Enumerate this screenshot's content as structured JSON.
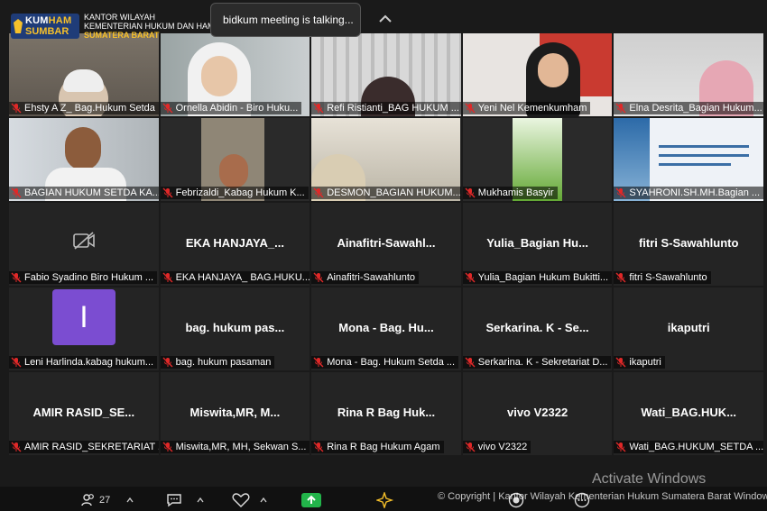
{
  "app": {
    "logo": {
      "badge_line1_a": "KUM",
      "badge_line1_b": "HAM",
      "badge_line2": "SUMBAR",
      "line1": "KANTOR WILAYAH",
      "line2": "KEMENTERIAN HUKUM DAN HAM",
      "line3": "SUMATERA BARAT"
    },
    "talking_indicator": "bidkum meeting is talking...",
    "watermark": "Activate Windows",
    "copyright": "© Copyright | Kantor Wilayah Kementerian Hukum Sumatera Barat Window"
  },
  "participants": [
    {
      "label": "Ehsty A Z_ Bag.Hukum Setda ...",
      "type": "video",
      "scene": "room-grey"
    },
    {
      "label": "Ornella Abidin - Biro Huku...",
      "type": "video",
      "scene": "hijab-white"
    },
    {
      "label": "Refi Ristianti_BAG HUKUM ...",
      "type": "video",
      "scene": "blinds"
    },
    {
      "label": "Yeni Nel Kemenkumham",
      "type": "video",
      "scene": "red-banner"
    },
    {
      "label": "Elna Desrita_Bagian Hukum...",
      "type": "video",
      "scene": "pink-hijab"
    },
    {
      "label": "BAGIAN HUKUM SETDA KA...",
      "type": "video",
      "scene": "man-office"
    },
    {
      "label": "Febrizaldi_Kabag Hukum K...",
      "type": "video",
      "scene": "man-dark"
    },
    {
      "label": "DESMON_BAGIAN HUKUM...",
      "type": "video",
      "scene": "ceiling"
    },
    {
      "label": "Mukhamis Basyir",
      "type": "video",
      "scene": "grass"
    },
    {
      "label": "SYAHRONI.SH.MH.Bagian ...",
      "type": "video",
      "scene": "slide"
    },
    {
      "label": "Fabio Syadino Biro Hukum ...",
      "type": "camoff",
      "big": ""
    },
    {
      "label": "EKA HANJAYA_ BAG.HUKU...",
      "type": "name",
      "big": "EKA HANJAYA_..."
    },
    {
      "label": "Ainafitri-Sawahlunto",
      "type": "name",
      "big": "Ainafitri-Sawahl..."
    },
    {
      "label": "Yulia_Bagian Hukum Bukitti...",
      "type": "name",
      "big": "Yulia_Bagian Hu..."
    },
    {
      "label": "fitri S-Sawahlunto",
      "type": "name",
      "big": "fitri S-Sawahlunto"
    },
    {
      "label": "Leni Harlinda.kabag hukum...",
      "type": "avatar",
      "big": "I"
    },
    {
      "label": "bag. hukum pasaman",
      "type": "name",
      "big": "bag. hukum pas..."
    },
    {
      "label": "Mona - Bag. Hukum Setda ...",
      "type": "name",
      "big": "Mona - Bag. Hu..."
    },
    {
      "label": "Serkarina. K - Sekretariat D...",
      "type": "name",
      "big": "Serkarina. K - Se..."
    },
    {
      "label": "ikaputri",
      "type": "name",
      "big": "ikaputri"
    },
    {
      "label": "AMIR RASID_SEKRETARIAT ...",
      "type": "name",
      "big": "AMIR RASID_SE..."
    },
    {
      "label": "Miswita,MR, MH, Sekwan S...",
      "type": "name",
      "big": "Miswita,MR, M..."
    },
    {
      "label": "Rina R Bag Hukum Agam",
      "type": "name",
      "big": "Rina R Bag Huk..."
    },
    {
      "label": "vivo V2322",
      "type": "name",
      "big": "vivo V2322"
    },
    {
      "label": "Wati_BAG.HUKUM_SETDA ...",
      "type": "name",
      "big": "Wati_BAG.HUK..."
    }
  ],
  "toolbar": {
    "participants_count": "27"
  },
  "colors": {
    "mute_red": "#e02828",
    "avatar_purple": "#7b4dd1",
    "share_green": "#22b44a",
    "logo_blue": "#1f3c78",
    "logo_gold": "#f6c02a"
  }
}
